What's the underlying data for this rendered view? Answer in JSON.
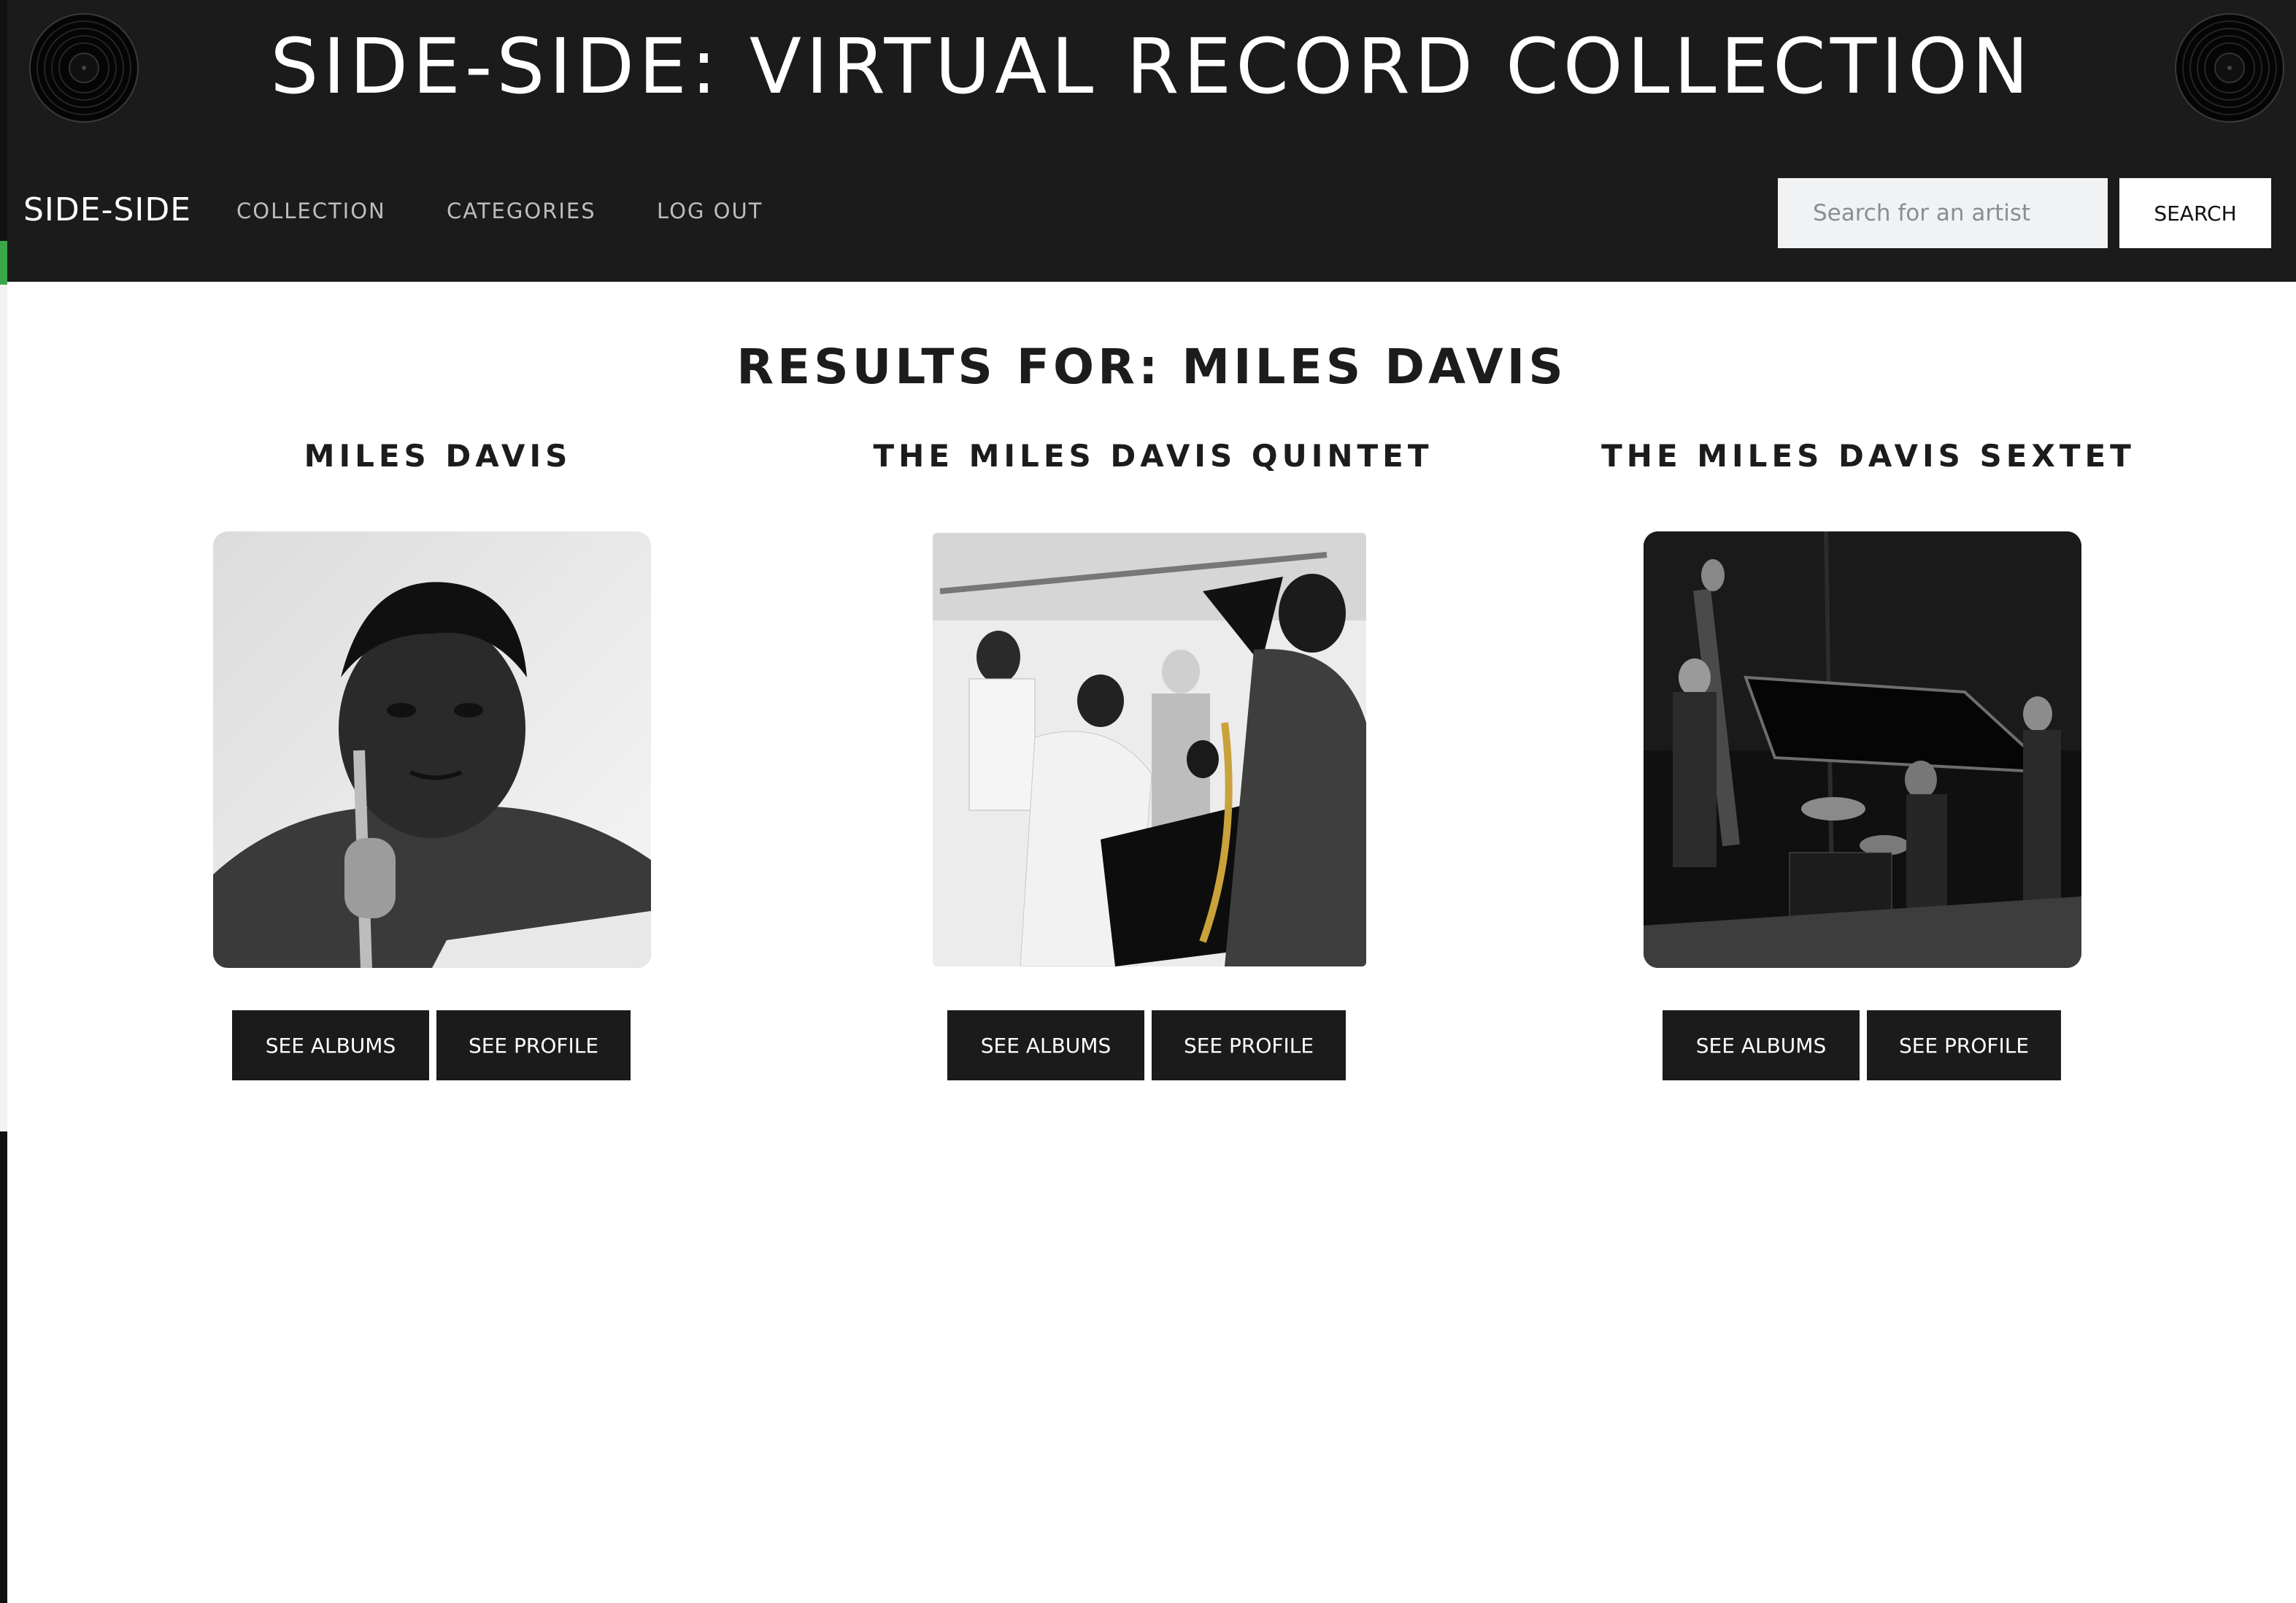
{
  "header": {
    "site_title": "SIDE-SIDE: VIRTUAL RECORD COLLECTION",
    "brand": "SIDE-SIDE",
    "nav": [
      "COLLECTION",
      "CATEGORIES",
      "LOG OUT"
    ],
    "search": {
      "placeholder": "Search for an artist",
      "value": "",
      "button_label": "SEARCH"
    },
    "decor_icon": "vinyl-record-icon"
  },
  "results": {
    "title": "RESULTS FOR: MILES DAVIS",
    "cards": [
      {
        "name": "MILES DAVIS",
        "image": "artist-photo",
        "albums_label": "SEE ALBUMS",
        "profile_label": "SEE PROFILE"
      },
      {
        "name": "THE MILES DAVIS QUINTET",
        "image": "artist-photo",
        "albums_label": "SEE ALBUMS",
        "profile_label": "SEE PROFILE"
      },
      {
        "name": "THE MILES DAVIS SEXTET",
        "image": "artist-photo",
        "albums_label": "SEE ALBUMS",
        "profile_label": "SEE PROFILE"
      }
    ]
  },
  "colors": {
    "header_bg": "#1b1b1b",
    "button_bg": "#1b1b1b",
    "text": "#1c1c1c",
    "nav_text": "#bdbdbd"
  }
}
